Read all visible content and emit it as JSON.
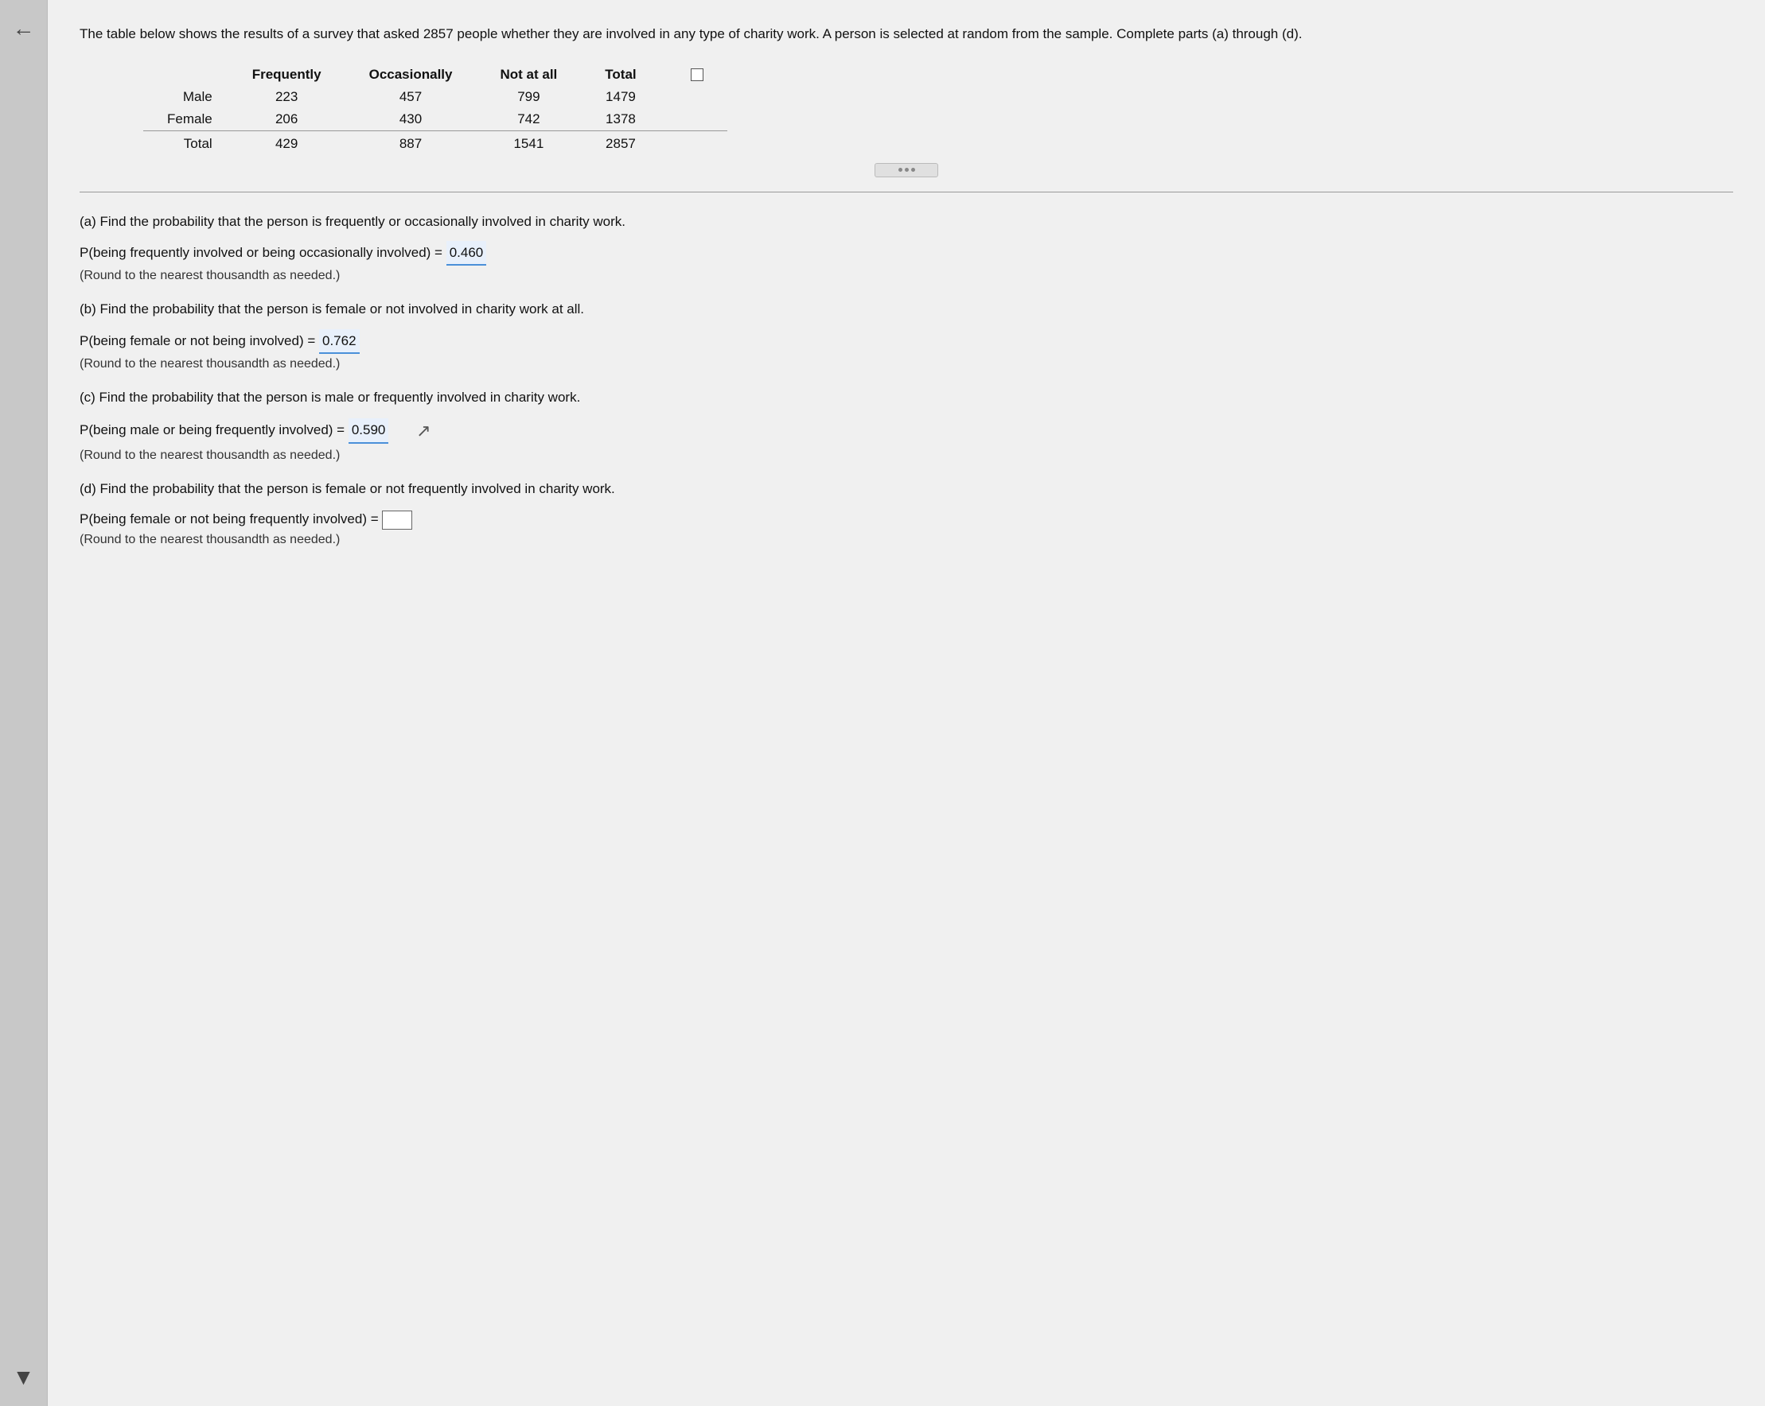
{
  "intro": {
    "text": "The table below shows the results of a survey that asked 2857 people whether they are involved in any type of charity work. A person is selected at random from the sample. Complete parts (a) through (d)."
  },
  "table": {
    "headers": [
      "",
      "Frequently",
      "Occasionally",
      "Not at all",
      "Total"
    ],
    "rows": [
      {
        "label": "Male",
        "frequently": "223",
        "occasionally": "457",
        "not_at_all": "799",
        "total": "1479"
      },
      {
        "label": "Female",
        "frequently": "206",
        "occasionally": "430",
        "not_at_all": "742",
        "total": "1378"
      },
      {
        "label": "Total",
        "frequently": "429",
        "occasionally": "887",
        "not_at_all": "1541",
        "total": "2857"
      }
    ]
  },
  "parts": {
    "a": {
      "question": "(a) Find the probability that the person is frequently or occasionally involved in charity work.",
      "formula": "P(being frequently involved or being occasionally involved) = ",
      "value": "0.460",
      "note": "(Round to the nearest thousandth as needed.)"
    },
    "b": {
      "question": "(b) Find the probability that the person is female or not involved in charity work at all.",
      "formula": "P(being female or not being involved) = ",
      "value": "0.762",
      "note": "(Round to the nearest thousandth as needed.)"
    },
    "c": {
      "question": "(c) Find the probability that the person is male or frequently involved in charity work.",
      "formula": "P(being male or being frequently involved) = ",
      "value": "0.590",
      "note": "(Round to the nearest thousandth as needed.)"
    },
    "d": {
      "question": "(d) Find the probability that the person is female or not frequently involved in charity work.",
      "formula": "P(being female or not being frequently involved) = ",
      "value": "",
      "note": "(Round to the nearest thousandth as needed.)"
    }
  },
  "left_bar": {
    "back_arrow": "←",
    "down_arrow": "▼"
  }
}
